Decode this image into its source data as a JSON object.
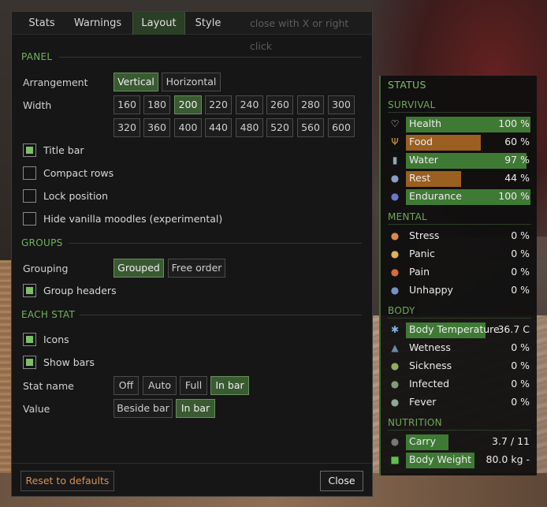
{
  "tabs": [
    {
      "label": "Stats"
    },
    {
      "label": "Warnings"
    },
    {
      "label": "Layout"
    },
    {
      "label": "Style"
    }
  ],
  "tab_hint": "close with X or right click",
  "panel": {
    "section": "PANEL",
    "arrangement_label": "Arrangement",
    "arrangement_options": [
      "Vertical",
      "Horizontal"
    ],
    "arrangement_selected": "Vertical",
    "width_label": "Width",
    "width_options": [
      "160",
      "180",
      "200",
      "220",
      "240",
      "260",
      "280",
      "300",
      "320",
      "360",
      "400",
      "440",
      "480",
      "520",
      "560",
      "600"
    ],
    "width_selected": "200",
    "checkboxes": [
      {
        "label": "Title bar",
        "checked": true
      },
      {
        "label": "Compact rows",
        "checked": false
      },
      {
        "label": "Lock position",
        "checked": false
      },
      {
        "label": "Hide vanilla moodles (experimental)",
        "checked": false
      }
    ]
  },
  "groups": {
    "section": "GROUPS",
    "grouping_label": "Grouping",
    "grouping_options": [
      "Grouped",
      "Free order"
    ],
    "grouping_selected": "Grouped",
    "group_headers": {
      "label": "Group headers",
      "checked": true
    }
  },
  "each_stat": {
    "section": "EACH STAT",
    "icons": {
      "label": "Icons",
      "checked": true
    },
    "show_bars": {
      "label": "Show bars",
      "checked": true
    },
    "stat_name_label": "Stat name",
    "stat_name_options": [
      "Off",
      "Auto",
      "Full",
      "In bar"
    ],
    "stat_name_selected": "In bar",
    "value_label": "Value",
    "value_options": [
      "Beside bar",
      "In bar"
    ],
    "value_selected": "In bar"
  },
  "footer": {
    "reset_label": "Reset to defaults",
    "close_label": "Close"
  },
  "colors": {
    "accent_green": "#3a5a32",
    "bar_green": "#3f7a35",
    "bar_orange": "#9a5f21",
    "reset_text": "#d59257"
  },
  "status": {
    "title": "STATUS",
    "survival": {
      "label": "SURVIVAL",
      "rows": [
        {
          "name": "Health",
          "value": "100 %",
          "fill": 1.0,
          "color": "green",
          "icon": "heart-icon"
        },
        {
          "name": "Food",
          "value": "60 %",
          "fill": 0.6,
          "color": "orange",
          "icon": "fork-knife-icon"
        },
        {
          "name": "Water",
          "value": "97 %",
          "fill": 0.97,
          "color": "green",
          "icon": "water-bottle-icon"
        },
        {
          "name": "Rest",
          "value": "44 %",
          "fill": 0.44,
          "color": "orange",
          "icon": "moon-icon"
        },
        {
          "name": "Endurance",
          "value": "100 %",
          "fill": 1.0,
          "color": "green",
          "icon": "runner-icon"
        }
      ]
    },
    "mental": {
      "label": "MENTAL",
      "rows": [
        {
          "name": "Stress",
          "value": "0 %",
          "icon": "stress-face-icon"
        },
        {
          "name": "Panic",
          "value": "0 %",
          "icon": "panic-face-icon"
        },
        {
          "name": "Pain",
          "value": "0 %",
          "icon": "pain-face-icon"
        },
        {
          "name": "Unhappy",
          "value": "0 %",
          "icon": "unhappy-face-icon"
        }
      ]
    },
    "body": {
      "label": "BODY",
      "rows": [
        {
          "name": "Body Temperature",
          "value": "36.7 C",
          "fill": 0.64,
          "color": "green",
          "icon": "snowflake-icon"
        },
        {
          "name": "Wetness",
          "value": "0 %",
          "icon": "droplet-icon"
        },
        {
          "name": "Sickness",
          "value": "0 %",
          "icon": "sick-face-icon"
        },
        {
          "name": "Infected",
          "value": "0 %",
          "icon": "zombie-face-icon"
        },
        {
          "name": "Fever",
          "value": "0 %",
          "icon": "fever-face-icon"
        }
      ]
    },
    "nutrition": {
      "label": "NUTRITION",
      "rows": [
        {
          "name": "Carry",
          "value": "3.7 / 11",
          "fill": 0.34,
          "color": "green",
          "icon": "weight-icon"
        },
        {
          "name": "Body Weight",
          "value": "80.0 kg  -",
          "fill": 0.55,
          "color": "green",
          "icon": "square-icon"
        }
      ]
    }
  }
}
